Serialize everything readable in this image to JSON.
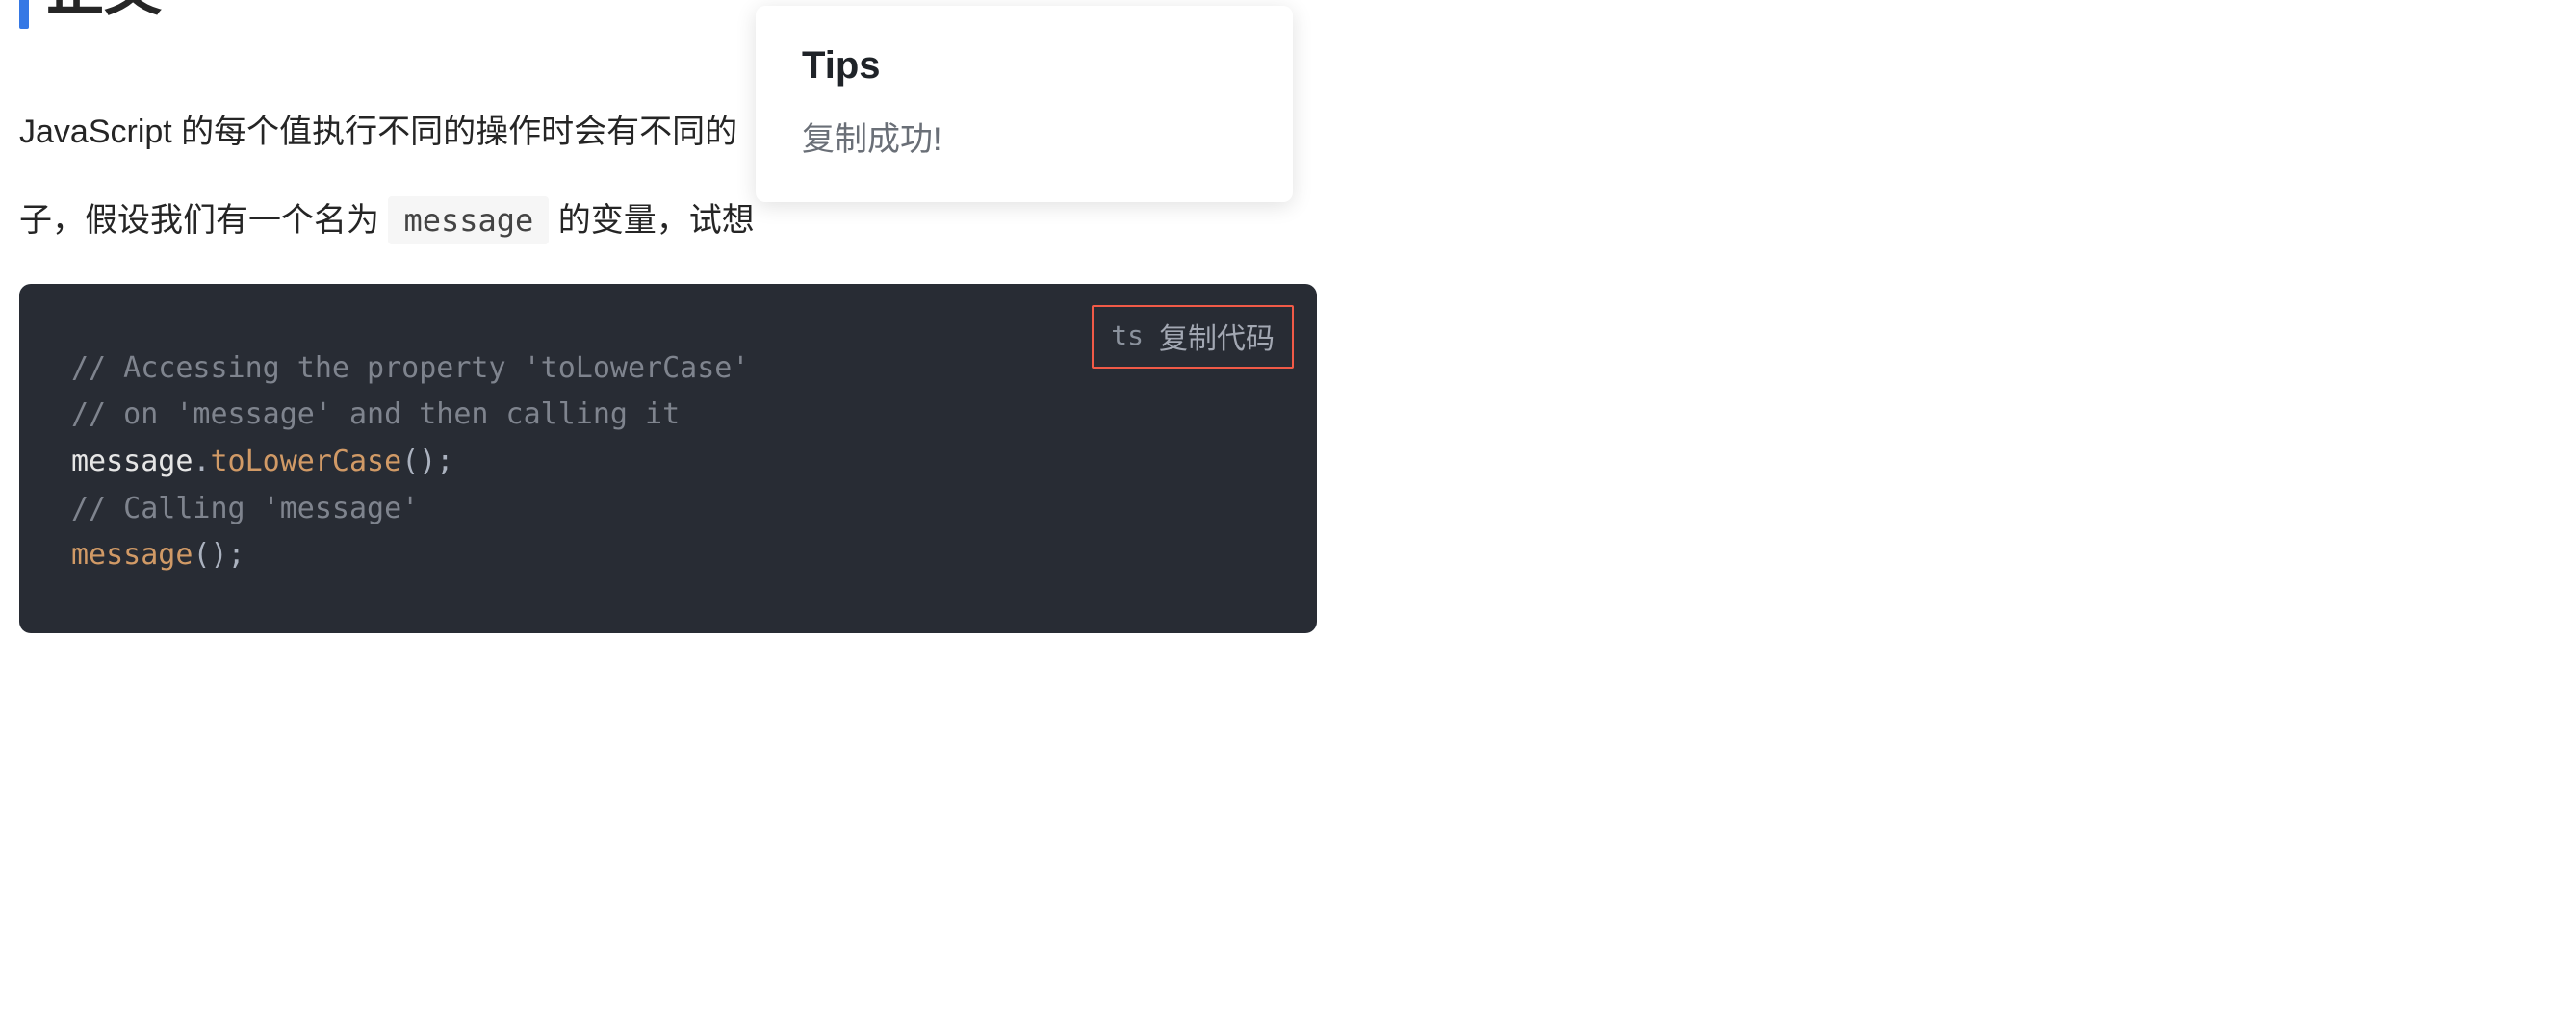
{
  "heading": {
    "text": "正文"
  },
  "paragraph": {
    "line1_prefix": "JavaScript 的每个值执行不同的操作时会有不同的",
    "line2_prefix": "子，假设我们有一个名为 ",
    "inline_code": "message",
    "line2_suffix": " 的变量，试想"
  },
  "code": {
    "lang": "ts",
    "copy_label": "复制代码",
    "c1": "// Accessing the property 'toLowerCase'",
    "c2": "// on 'message' and then calling it",
    "l3_obj": "message",
    "l3_dot": ".",
    "l3_method": "toLowerCase",
    "l3_paren": "();",
    "c4": "// Calling 'message'",
    "l5_call": "message",
    "l5_paren": "();"
  },
  "toast": {
    "title": "Tips",
    "message": "复制成功!"
  }
}
